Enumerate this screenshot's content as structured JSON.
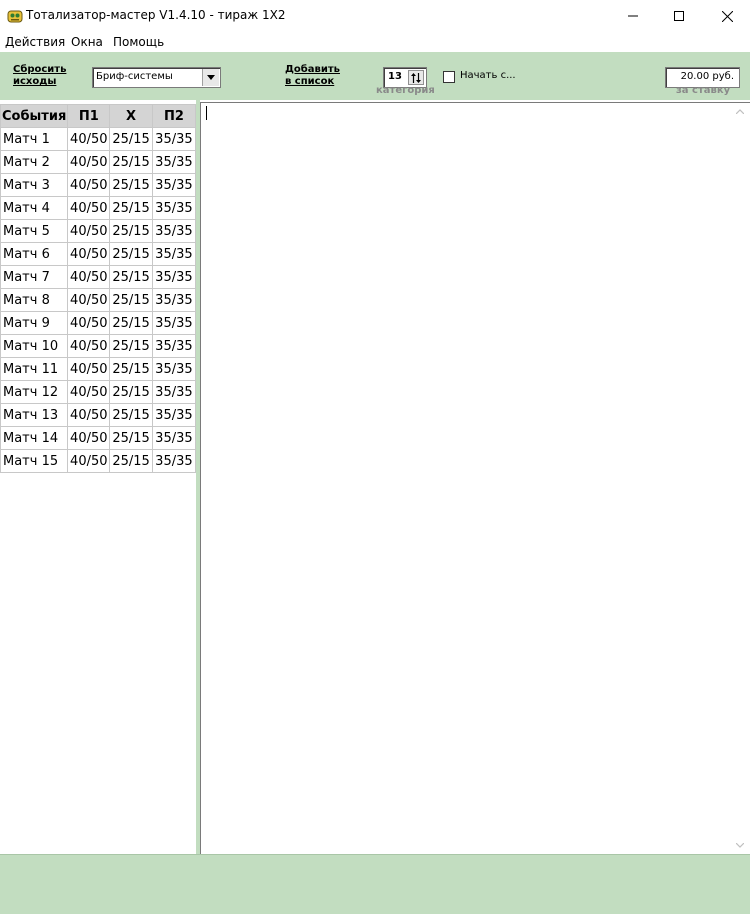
{
  "window": {
    "title": "Тотализатор-мастер V1.4.10 - тираж 1X2"
  },
  "menu": [
    "Действия",
    "Окна",
    "Помощь"
  ],
  "toolbar": {
    "reset_line1": "Сбросить",
    "reset_line2": "исходы",
    "system_select": "Бриф-системы",
    "add_line1": "Добавить",
    "add_line2": "в список",
    "category_value": "13",
    "category_label": "категория",
    "start_checkbox_label": "Начать с...",
    "stake_value": "20.00 руб.",
    "stake_label": "за ставку"
  },
  "grid": {
    "headers": [
      "События",
      "П1",
      "Х",
      "П2"
    ],
    "rows": [
      [
        "Матч 1",
        "40/50",
        "25/15",
        "35/35"
      ],
      [
        "Матч 2",
        "40/50",
        "25/15",
        "35/35"
      ],
      [
        "Матч 3",
        "40/50",
        "25/15",
        "35/35"
      ],
      [
        "Матч 4",
        "40/50",
        "25/15",
        "35/35"
      ],
      [
        "Матч 5",
        "40/50",
        "25/15",
        "35/35"
      ],
      [
        "Матч 6",
        "40/50",
        "25/15",
        "35/35"
      ],
      [
        "Матч 7",
        "40/50",
        "25/15",
        "35/35"
      ],
      [
        "Матч 8",
        "40/50",
        "25/15",
        "35/35"
      ],
      [
        "Матч 9",
        "40/50",
        "25/15",
        "35/35"
      ],
      [
        "Матч 10",
        "40/50",
        "25/15",
        "35/35"
      ],
      [
        "Матч 11",
        "40/50",
        "25/15",
        "35/35"
      ],
      [
        "Матч 12",
        "40/50",
        "25/15",
        "35/35"
      ],
      [
        "Матч 13",
        "40/50",
        "25/15",
        "35/35"
      ],
      [
        "Матч 14",
        "40/50",
        "25/15",
        "35/35"
      ],
      [
        "Матч 15",
        "40/50",
        "25/15",
        "35/35"
      ]
    ]
  },
  "colors": {
    "panel_green": "#c2ddc0",
    "header_gray": "#d4d4d4"
  }
}
